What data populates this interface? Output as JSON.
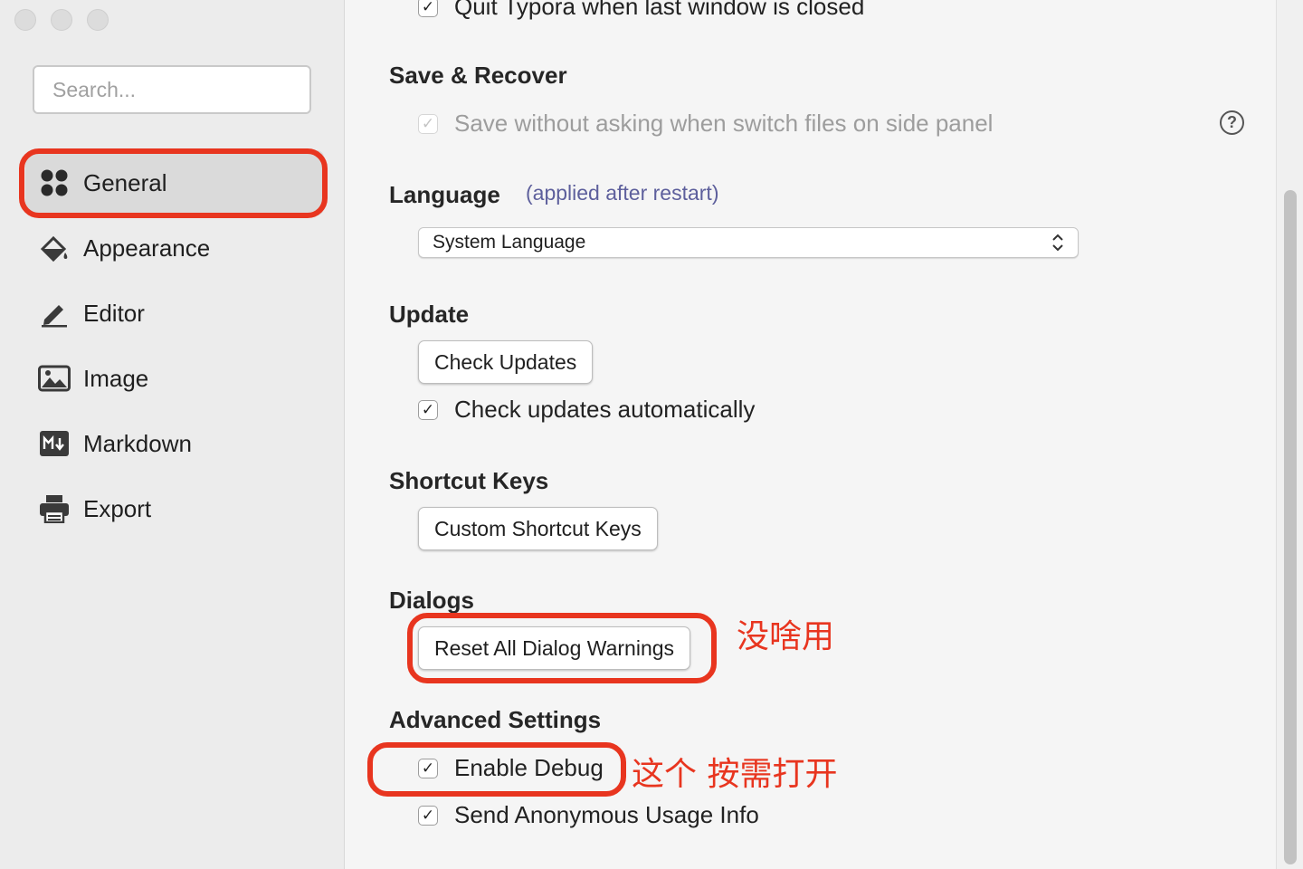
{
  "sidebar": {
    "search_placeholder": "Search...",
    "items": [
      {
        "label": "General",
        "icon": "grid-icon",
        "active": true
      },
      {
        "label": "Appearance",
        "icon": "paint-bucket-icon"
      },
      {
        "label": "Editor",
        "icon": "pencil-icon"
      },
      {
        "label": "Image",
        "icon": "image-icon"
      },
      {
        "label": "Markdown",
        "icon": "markdown-icon"
      },
      {
        "label": "Export",
        "icon": "printer-icon"
      }
    ]
  },
  "main": {
    "quit_option": {
      "label": "Quit Typora when last window is closed",
      "checked": true
    },
    "save_recover": {
      "heading": "Save & Recover",
      "option": {
        "label": "Save without asking when switch files on side panel",
        "checked": true,
        "disabled": true
      },
      "help_label": "?"
    },
    "language": {
      "heading": "Language",
      "note": "(applied after restart)",
      "selected": "System Language"
    },
    "update": {
      "heading": "Update",
      "check_button": "Check Updates",
      "auto_option": {
        "label": "Check updates automatically",
        "checked": true
      }
    },
    "shortcut": {
      "heading": "Shortcut Keys",
      "button": "Custom Shortcut Keys"
    },
    "dialogs": {
      "heading": "Dialogs",
      "button": "Reset All Dialog Warnings"
    },
    "advanced": {
      "heading": "Advanced Settings",
      "debug": {
        "label": "Enable Debug",
        "checked": true
      },
      "usage": {
        "label": "Send Anonymous Usage Info",
        "checked": true
      }
    }
  },
  "annotations": {
    "dialogs_note": "没啥用",
    "debug_note": "这个 按需打开",
    "color": "#e8351f"
  },
  "check_glyph": "✓"
}
